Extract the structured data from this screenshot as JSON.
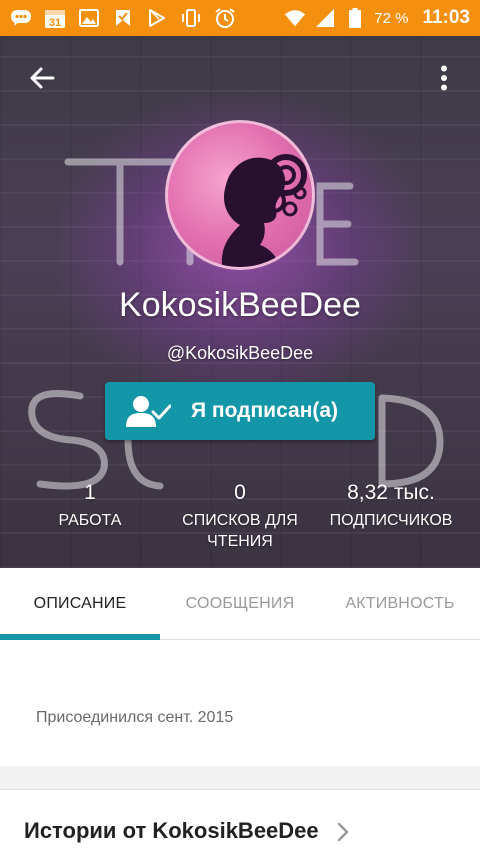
{
  "status_bar": {
    "battery_percent": "72 %",
    "time": "11:03",
    "calendar_day": "31",
    "icons": [
      "chat-icon",
      "calendar-icon",
      "image-icon",
      "flag-icon",
      "play-store-icon",
      "vibrate-icon",
      "alarm-icon",
      "wifi-icon",
      "signal-icon",
      "battery-icon"
    ]
  },
  "header": {
    "back_icon": "arrow-left-icon",
    "more_icon": "more-vertical-icon",
    "username": "KokosikBeeDee",
    "handle": "@KokosikBeeDee",
    "follow_button": "Я подписан(а)",
    "colors": {
      "accent": "#1296a8",
      "status_bar": "#f5900f"
    }
  },
  "stats": [
    {
      "value": "1",
      "label": "РАБОТА"
    },
    {
      "value": "0",
      "label_line1": "СПИСКОВ ДЛЯ",
      "label_line2": "ЧТЕНИЯ"
    },
    {
      "value": "8,32 тыс.",
      "label": "ПОДПИСЧИКОВ"
    }
  ],
  "tabs": [
    {
      "label": "ОПИСАНИЕ",
      "active": true
    },
    {
      "label": "СООБЩЕНИЯ",
      "active": false
    },
    {
      "label": "АКТИВНОСТЬ",
      "active": false
    }
  ],
  "about": {
    "joined": "Присоединился сент. 2015"
  },
  "stories": {
    "title": "Истории от KokosikBeeDee"
  }
}
